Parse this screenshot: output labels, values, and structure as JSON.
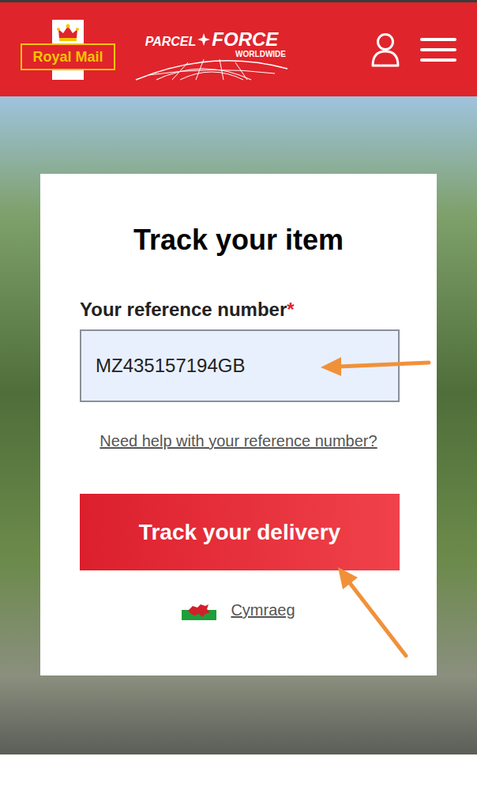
{
  "header": {
    "logo": {
      "text": "Royal Mail"
    },
    "brand": {
      "top": "PARCEL",
      "main": "FORCE",
      "sub": "WORLDWIDE"
    }
  },
  "card": {
    "title": "Track your item",
    "field": {
      "label": "Your reference number",
      "required": "*",
      "value": "MZ435157194GB"
    },
    "help_link": "Need help with your reference number?",
    "button": "Track your delivery",
    "language_link": "Cymraeg"
  }
}
